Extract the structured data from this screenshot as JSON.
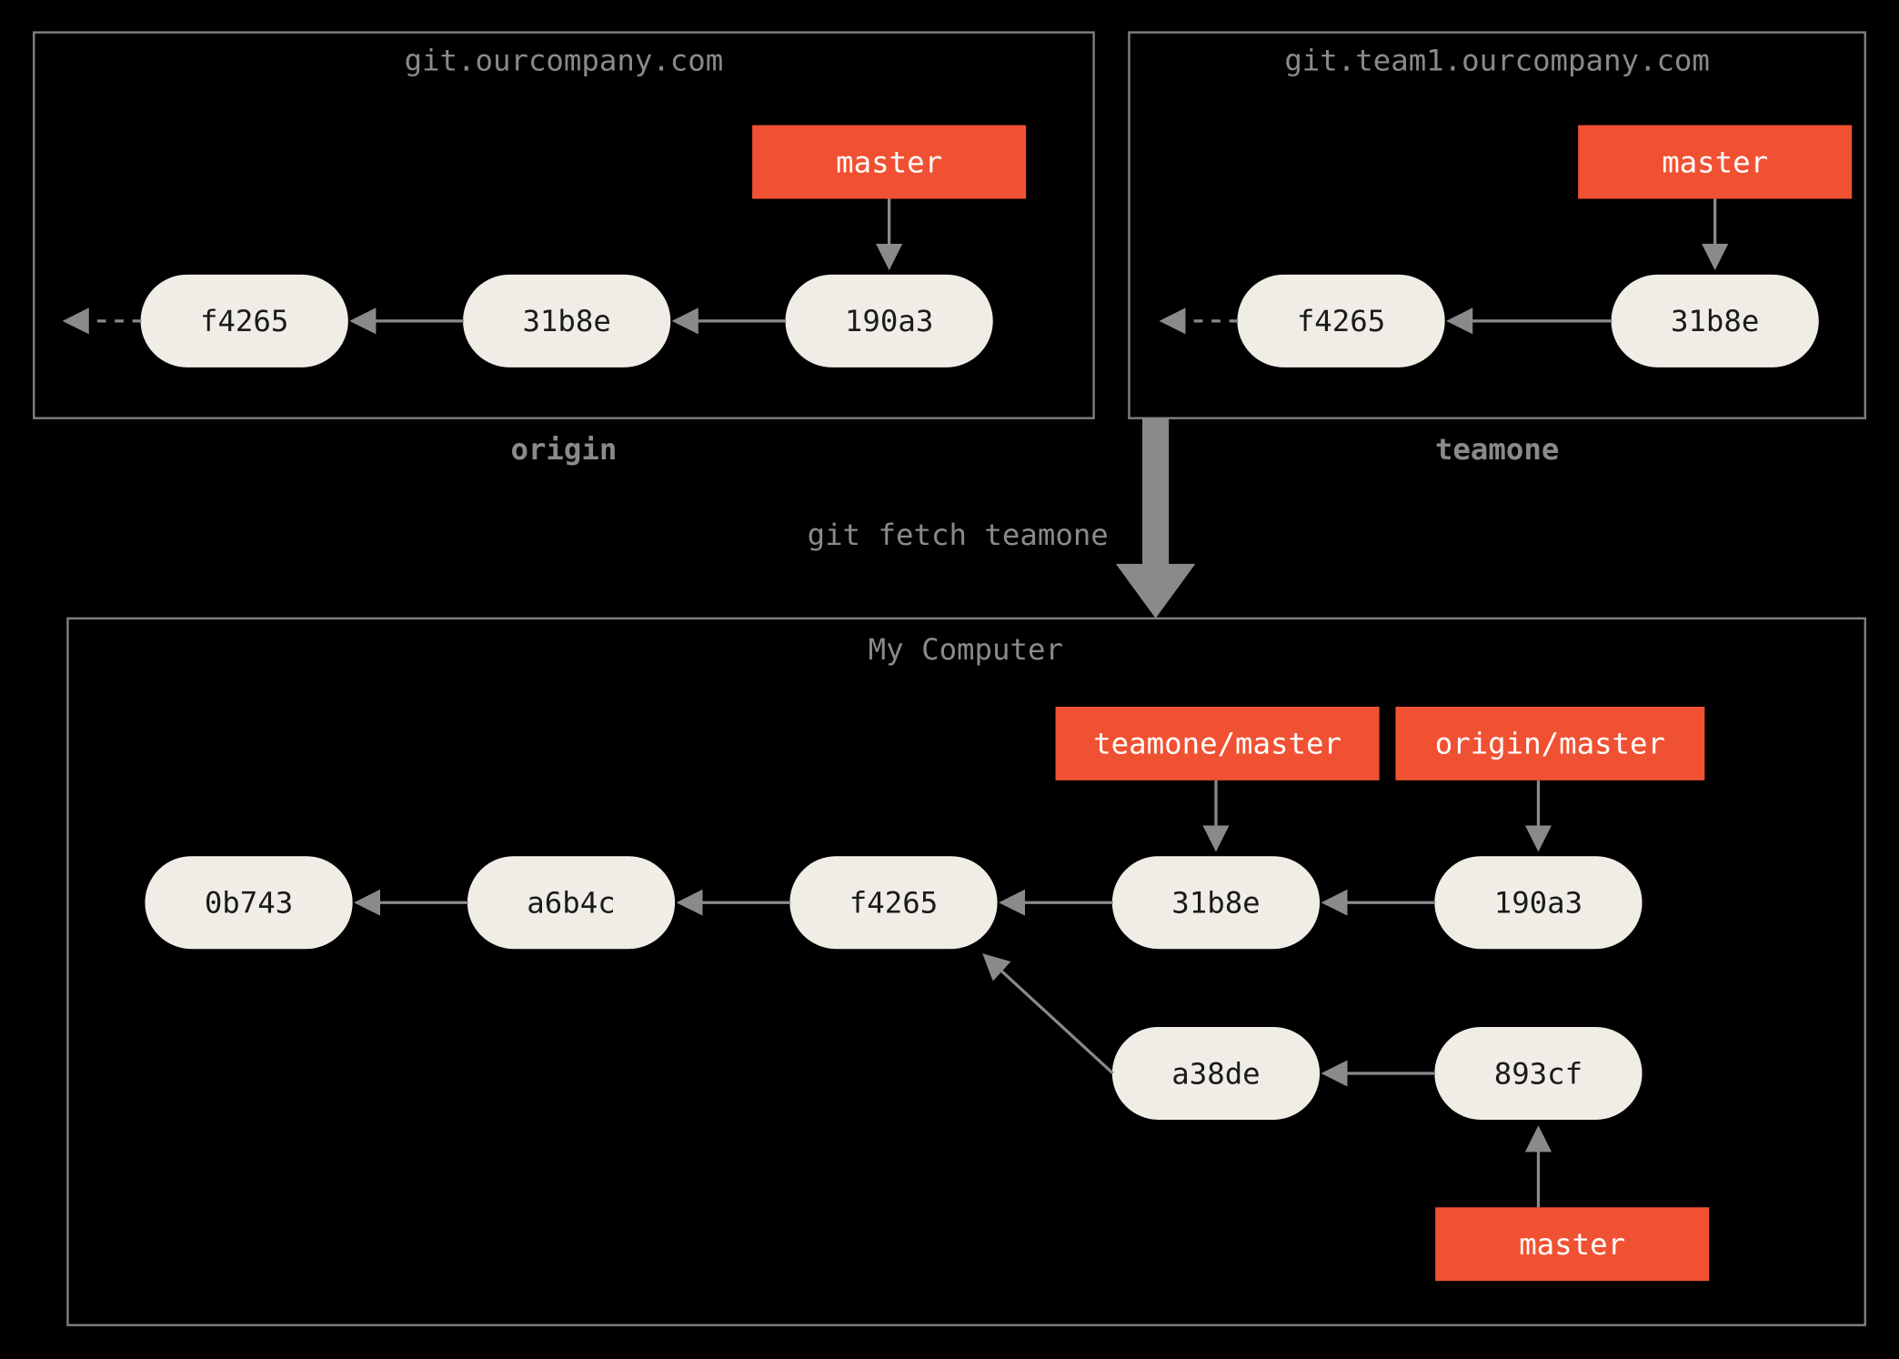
{
  "remotes": {
    "origin": {
      "url": "git.ourcompany.com",
      "name": "origin",
      "branch": "master",
      "commits": [
        "f4265",
        "31b8e",
        "190a3"
      ]
    },
    "teamone": {
      "url": "git.team1.ourcompany.com",
      "name": "teamone",
      "branch": "master",
      "commits": [
        "f4265",
        "31b8e"
      ]
    }
  },
  "action": "git fetch teamone",
  "local": {
    "title": "My Computer",
    "remote_branches": {
      "teamone": "teamone/master",
      "origin": "origin/master"
    },
    "local_branch": "master",
    "main_line": [
      "0b743",
      "a6b4c",
      "f4265",
      "31b8e",
      "190a3"
    ],
    "fork_line": [
      "a38de",
      "893cf"
    ]
  },
  "colors": {
    "commit": "#efede6",
    "branch": "#f05133",
    "bg": "#000000",
    "dim": "#8a8a8a"
  }
}
